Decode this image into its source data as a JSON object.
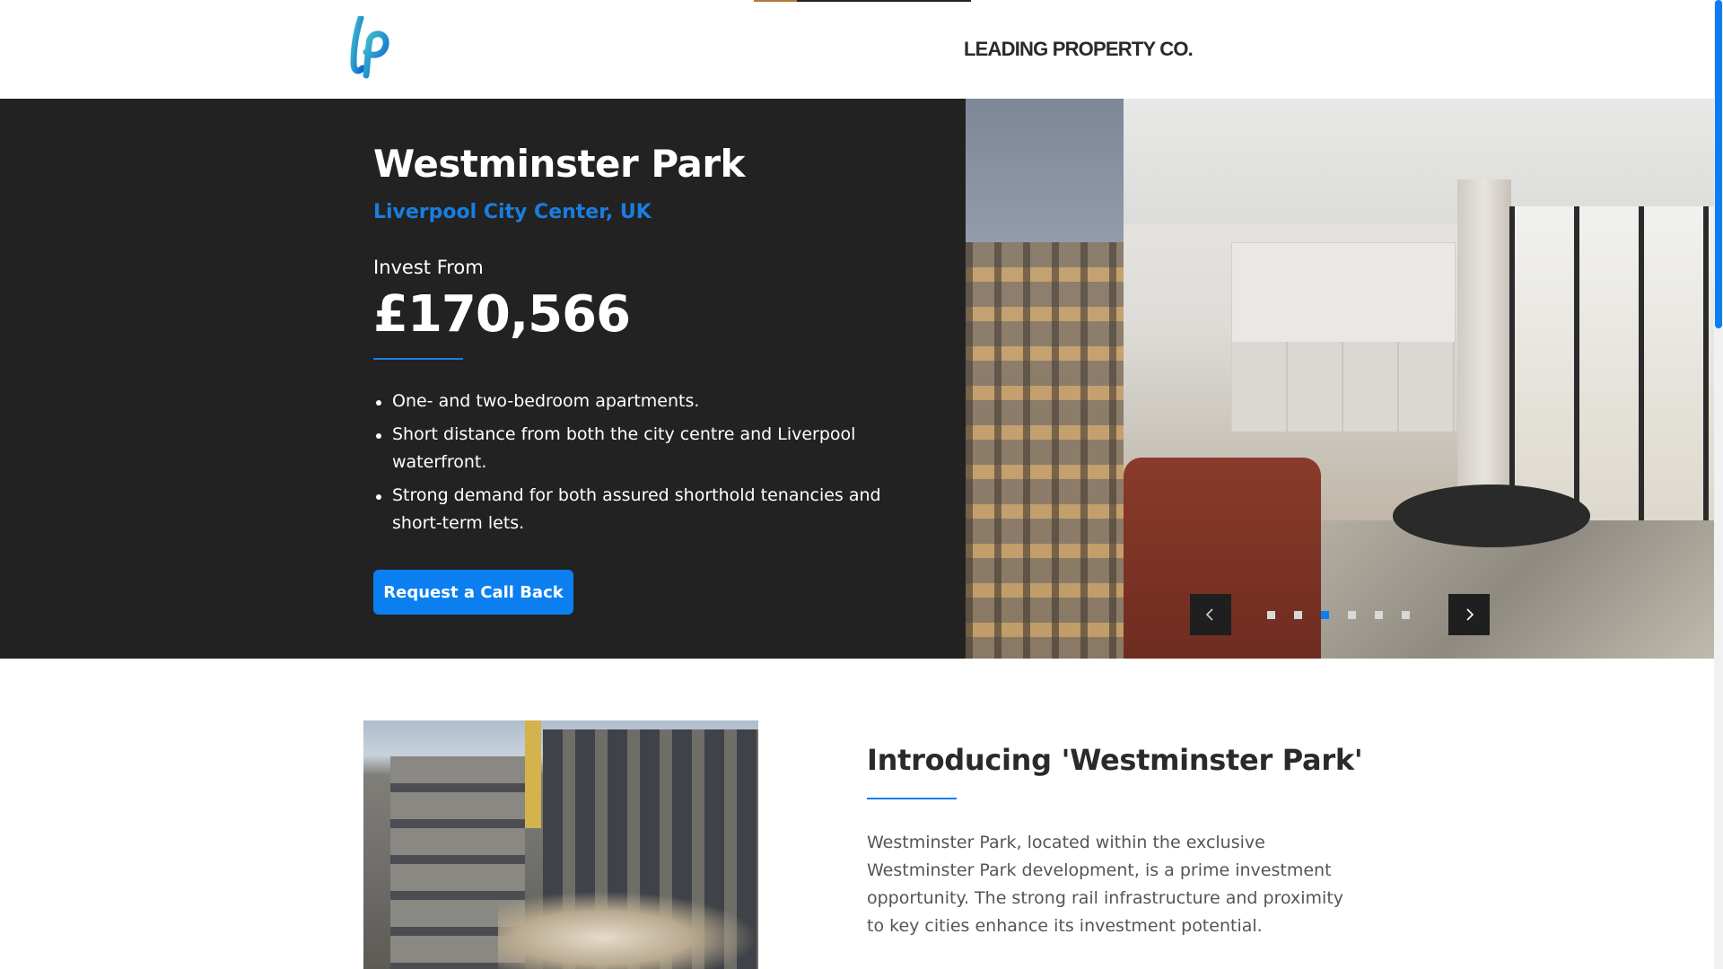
{
  "header": {
    "brand": "LEADING PROPERTY CO.",
    "logo_icon": "lp-logo-icon",
    "colors": {
      "logo_primary": "#0b7ff0",
      "logo_secondary": "#3fc1c9"
    }
  },
  "hero": {
    "title": "Westminster Park",
    "location": "Liverpool City Center, UK",
    "invest_label": "Invest From",
    "invest_price": "£170,566",
    "features": [
      "One- and two-bedroom apartments.",
      "Short distance from both the city centre and Liverpool waterfront.",
      "Strong demand for both assured shorthold tenancies and short-term lets."
    ],
    "cta_label": "Request a Call Back",
    "background_color": "#222222",
    "accent_color": "#0b7ff0"
  },
  "slider": {
    "prev_icon": "chevron-left-icon",
    "next_icon": "chevron-right-icon",
    "dot_count": 6,
    "active_index": 2
  },
  "intro": {
    "title": "Introducing 'Westminster Park'",
    "body": "Westminster Park, located within the exclusive Westminster Park development, is a prime investment opportunity. The strong rail infrastructure and proximity to key cities enhance its investment potential."
  }
}
